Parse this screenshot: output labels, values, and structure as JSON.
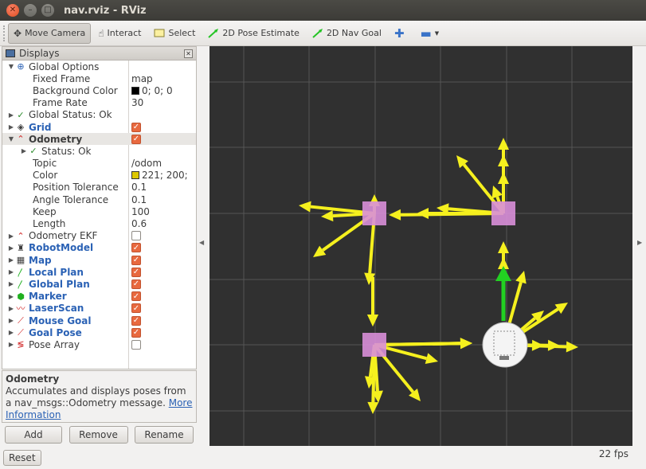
{
  "window": {
    "title": "nav.rviz - RViz"
  },
  "toolbar": {
    "tools": [
      {
        "label": "Move Camera",
        "icon": "move-camera-icon",
        "active": true
      },
      {
        "label": "Interact",
        "icon": "hand-icon",
        "active": false
      },
      {
        "label": "Select",
        "icon": "select-icon",
        "active": false
      },
      {
        "label": "2D Pose Estimate",
        "icon": "green-arrow-icon",
        "active": false
      },
      {
        "label": "2D Nav Goal",
        "icon": "green-arrow-icon",
        "active": false
      }
    ]
  },
  "displays_panel": {
    "title": "Displays",
    "global_options": {
      "label": "Global Options"
    },
    "fixed_frame": {
      "label": "Fixed Frame",
      "value": "map"
    },
    "background_color": {
      "label": "Background Color",
      "value": "0; 0; 0",
      "color": "#000000"
    },
    "frame_rate": {
      "label": "Frame Rate",
      "value": "30"
    },
    "global_status": {
      "label": "Global Status: Ok"
    },
    "grid": {
      "label": "Grid",
      "checked": true
    },
    "odometry": {
      "label": "Odometry",
      "checked": true
    },
    "odom_status": {
      "label": "Status: Ok"
    },
    "topic": {
      "label": "Topic",
      "value": "/odom"
    },
    "color": {
      "label": "Color",
      "value": "221; 200;",
      "color": "#ddc800"
    },
    "position_tolerance": {
      "label": "Position Tolerance",
      "value": "0.1"
    },
    "angle_tolerance": {
      "label": "Angle Tolerance",
      "value": "0.1"
    },
    "keep": {
      "label": "Keep",
      "value": "100"
    },
    "length": {
      "label": "Length",
      "value": "0.6"
    },
    "plugins": [
      {
        "label": "Odometry EKF",
        "checked": false
      },
      {
        "label": "RobotModel",
        "checked": true
      },
      {
        "label": "Map",
        "checked": true
      },
      {
        "label": "Local Plan",
        "checked": true
      },
      {
        "label": "Global Plan",
        "checked": true
      },
      {
        "label": "Marker",
        "checked": true
      },
      {
        "label": "LaserScan",
        "checked": true
      },
      {
        "label": "Mouse Goal",
        "checked": true
      },
      {
        "label": "Goal Pose",
        "checked": true
      },
      {
        "label": "Pose Array",
        "checked": false
      }
    ]
  },
  "description": {
    "title": "Odometry",
    "text": "Accumulates and displays poses from a nav_msgs::Odometry message.",
    "link": "More Information"
  },
  "buttons": {
    "add": "Add",
    "remove": "Remove",
    "rename": "Rename"
  },
  "statusbar": {
    "reset": "Reset",
    "fps": "22 fps"
  },
  "colors": {
    "arrow": "#f5f01e",
    "pose_box": "#d98fd9",
    "heading": "#22d022",
    "grid_line": "#555555",
    "view_bg": "#303030"
  }
}
